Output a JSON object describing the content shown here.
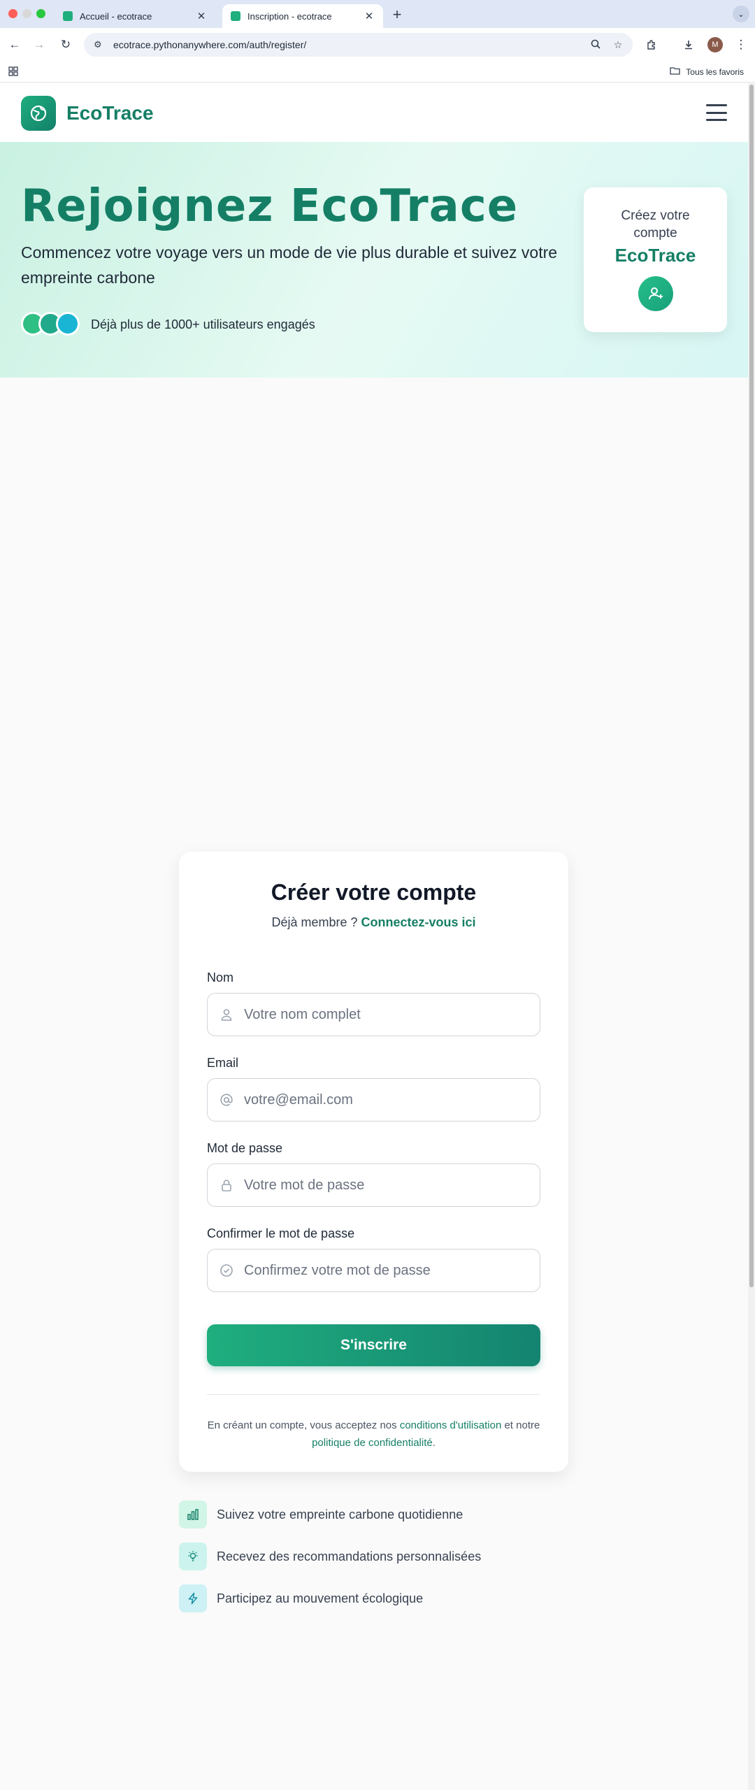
{
  "browser": {
    "tabs": [
      {
        "title": "Accueil - ecotrace",
        "active": false
      },
      {
        "title": "Inscription - ecotrace",
        "active": true
      }
    ],
    "url": "ecotrace.pythonanywhere.com/auth/register/",
    "bookmarks_label": "Tous les favoris",
    "profile_initial": "M",
    "icons": [
      "back-icon",
      "forward-icon",
      "reload-icon",
      "site-info-icon",
      "zoom-icon",
      "star-icon",
      "extensions-icon",
      "download-icon",
      "menu-icon",
      "apps-icon",
      "folder-icon"
    ]
  },
  "header": {
    "brand": "EcoTrace",
    "logo_icon": "leaf-globe-icon",
    "menu_icon": "hamburger-icon"
  },
  "hero": {
    "title": "Rejoignez EcoTrace",
    "subtitle": "Commencez votre voyage vers un mode de vie plus durable et suivez votre empreinte carbone",
    "users_text": "Déjà plus de 1000+ utilisateurs engagés",
    "card_text": "Créez votre compte",
    "card_brand": "EcoTrace",
    "card_icon": "user-plus-icon"
  },
  "form": {
    "title": "Créer votre compte",
    "login_prompt": "Déjà membre ?",
    "login_link": "Connectez-vous ici",
    "fields": [
      {
        "label": "Nom",
        "placeholder": "Votre nom complet",
        "icon": "user-icon"
      },
      {
        "label": "Email",
        "placeholder": "votre@email.com",
        "icon": "at-icon"
      },
      {
        "label": "Mot de passe",
        "placeholder": "Votre mot de passe",
        "icon": "lock-icon"
      },
      {
        "label": "Confirmer le mot de passe",
        "placeholder": "Confirmez votre mot de passe",
        "icon": "check-circle-icon"
      }
    ],
    "submit": "S'inscrire",
    "terms": {
      "part1": "En créant un compte, vous acceptez nos",
      "link1": "conditions d'utilisation",
      "part2": "et notre",
      "link2": "politique de confidentialité",
      "part3": "."
    }
  },
  "features": [
    {
      "text": "Suivez votre empreinte carbone quotidienne",
      "icon": "bar-chart-icon"
    },
    {
      "text": "Recevez des recommandations personnalisées",
      "icon": "lightbulb-icon"
    },
    {
      "text": "Participez au mouvement écologique",
      "icon": "lightning-icon"
    }
  ],
  "colors": {
    "brand": "#157f66",
    "accent": "#1fae7e",
    "hero_bg": "#d7f6ec"
  }
}
